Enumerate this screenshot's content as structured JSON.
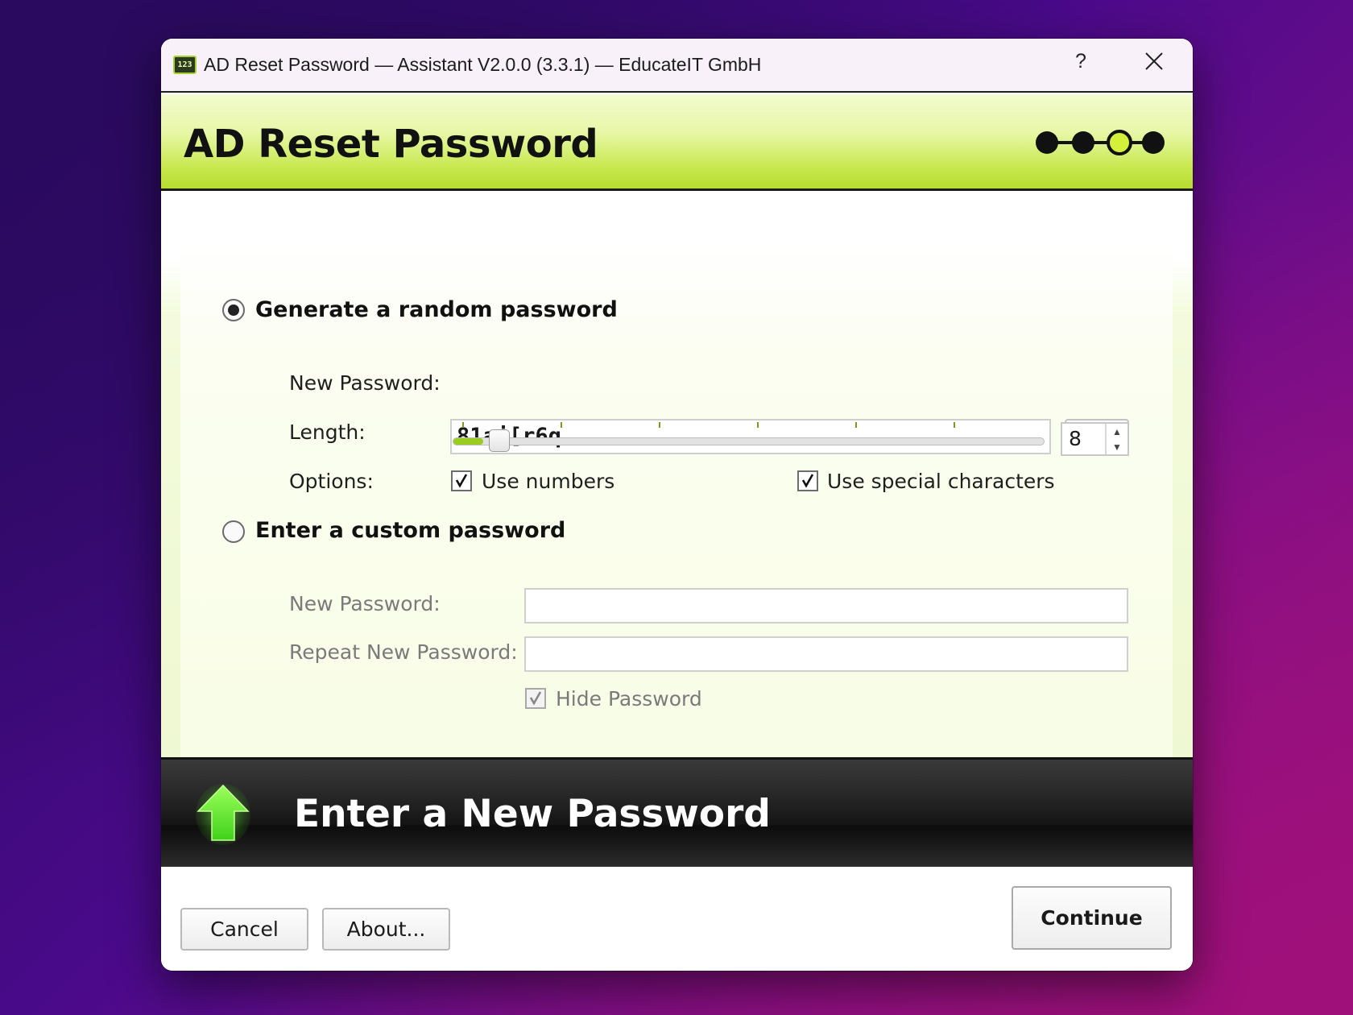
{
  "window": {
    "title": "AD Reset Password — Assistant V2.0.0 (3.3.1) — EducateIT GmbH",
    "icon": "app-icon",
    "icon_text": "123",
    "help_label": "?",
    "close_icon": "close-icon"
  },
  "header": {
    "title": "AD Reset Password",
    "steps": {
      "total": 4,
      "current": 3
    }
  },
  "random": {
    "radio_label": "Generate a random password",
    "selected": true,
    "new_password_label": "New Password:",
    "new_password_value": "81aj[r6q",
    "regenerate_icon": "refresh-icon",
    "length_label": "Length:",
    "length_value": "8",
    "length_fraction": 0.05,
    "options_label": "Options:",
    "use_numbers_label": "Use numbers",
    "use_numbers_checked": true,
    "use_special_label": "Use special characters",
    "use_special_checked": true
  },
  "custom": {
    "radio_label": "Enter a custom password",
    "selected": false,
    "new_password_label": "New Password:",
    "new_password_value": "",
    "repeat_password_label": "Repeat New Password:",
    "repeat_password_value": "",
    "hide_password_label": "Hide Password",
    "hide_password_checked": true
  },
  "footer_banner": {
    "title": "Enter a New Password",
    "icon": "green-up-arrow-icon"
  },
  "buttons": {
    "cancel": "Cancel",
    "about": "About...",
    "continue": "Continue"
  },
  "colors": {
    "accent_green": "#b6dc30",
    "step_active": "#d4f03a"
  }
}
